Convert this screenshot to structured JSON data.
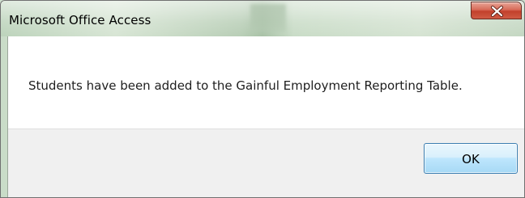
{
  "dialog": {
    "title": "Microsoft Office Access",
    "message": "Students have been added to the Gainful Employment Reporting Table.",
    "ok_label": "OK"
  },
  "icons": {
    "close": "close-icon"
  },
  "colors": {
    "close_button": "#c94a36",
    "ok_button_border": "#3c7fb1",
    "footer_background": "#f0f0f0"
  }
}
